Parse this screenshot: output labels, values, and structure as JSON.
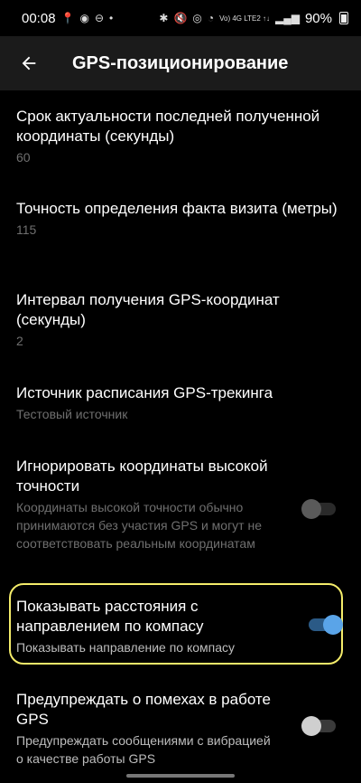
{
  "status_bar": {
    "time": "00:08",
    "network": "Vo) 4G LTE2 ↑↓",
    "battery": "90%"
  },
  "app_bar": {
    "title": "GPS-позиционирование"
  },
  "settings": [
    {
      "title": "Срок актуальности последней полученной координаты (секунды)",
      "summary": "60"
    },
    {
      "title": "Точность определения факта визита (метры)",
      "summary": "115"
    },
    {
      "title": "Интервал получения GPS-координат (секунды)",
      "summary": "2"
    },
    {
      "title": "Источник расписания GPS-трекинга",
      "summary": "Тестовый источник"
    },
    {
      "title": "Игнорировать координаты высокой точности",
      "summary": "Координаты высокой точности обычно принимаются без участия GPS и могут не соответствовать реальным координатам",
      "toggle_on": false,
      "enabled": false
    },
    {
      "title": "Показывать расстояния с направлением по компасу",
      "summary": "Показывать направление по компасу",
      "toggle_on": true,
      "enabled": true
    },
    {
      "title": "Предупреждать о помехах в работе GPS",
      "summary": "Предупреждать сообщениями с вибрацией о качестве работы GPS",
      "toggle_on": false,
      "enabled": true
    }
  ],
  "colors": {
    "background": "#000000",
    "app_bar": "#1b1b1b",
    "accent": "#5aa4e8",
    "highlight": "#f4ec6a",
    "secondary_text": "#6f6f6f"
  }
}
